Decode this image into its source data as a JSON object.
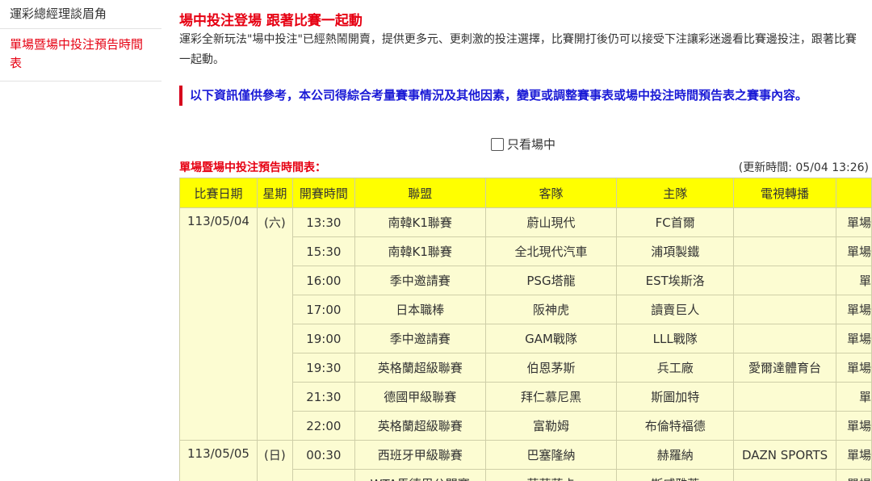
{
  "sidebar": {
    "items": [
      {
        "label": "運彩總經理談眉角",
        "active": false
      },
      {
        "label": "單場暨場中投注預告時間表",
        "active": true
      }
    ]
  },
  "main": {
    "headline": "場中投注登場 跟著比賽一起動",
    "intro": "運彩全新玩法\"場中投注\"已經熱鬧開賣，提供更多元、更刺激的投注選擇，比賽開打後仍可以接受下注讓彩迷邊看比賽邊投注，跟著比賽一起動。",
    "notice": "以下資訊僅供參考，本公司得綜合考量賽事情況及其他因素，變更或調整賽事表或場中投注時間預告表之賽事內容。",
    "filter_label": "只看場中",
    "filter_checked": false,
    "table_title": "單場暨場中投注預告時間表：",
    "update_time": "(更新時間: 05/04 13:26)"
  },
  "table": {
    "headers": [
      "比賽日期",
      "星期",
      "開賽時間",
      "聯盟",
      "客隊",
      "主隊",
      "電視轉播",
      ""
    ],
    "groups": [
      {
        "date": "113/05/04",
        "day": "(六)",
        "rows": [
          {
            "time": "13:30",
            "league": "南韓K1聯賽",
            "away": "蔚山現代",
            "home": "FC首爾",
            "tv": "",
            "type": "單場"
          },
          {
            "time": "15:30",
            "league": "南韓K1聯賽",
            "away": "全北現代汽車",
            "home": "浦項製鐵",
            "tv": "",
            "type": "單場"
          },
          {
            "time": "16:00",
            "league": "季中邀請賽",
            "away": "PSG塔龍",
            "home": "EST埃斯洛",
            "tv": "",
            "type": "單"
          },
          {
            "time": "17:00",
            "league": "日本職棒",
            "away": "阪神虎",
            "home": "讀賣巨人",
            "tv": "",
            "type": "單場"
          },
          {
            "time": "19:00",
            "league": "季中邀請賽",
            "away": "GAM戰隊",
            "home": "LLL戰隊",
            "tv": "",
            "type": "單場"
          },
          {
            "time": "19:30",
            "league": "英格蘭超級聯賽",
            "away": "伯恩茅斯",
            "home": "兵工廠",
            "tv": "愛爾達體育台",
            "type": "單場"
          },
          {
            "time": "21:30",
            "league": "德國甲級聯賽",
            "away": "拜仁慕尼黑",
            "home": "斯圖加特",
            "tv": "",
            "type": "單"
          },
          {
            "time": "22:00",
            "league": "英格蘭超級聯賽",
            "away": "富勒姆",
            "home": "布倫特福德",
            "tv": "",
            "type": "單場"
          }
        ]
      },
      {
        "date": "113/05/05",
        "day": "(日)",
        "rows": [
          {
            "time": "00:30",
            "league": "西班牙甲級聯賽",
            "away": "巴塞隆納",
            "home": "赫羅納",
            "tv": "DAZN SPORTS",
            "type": "單場"
          },
          {
            "time": "",
            "league": "WTA馬德里公開賽",
            "away": "莎莉蓮卡",
            "home": "斯威雅蒂",
            "tv": "",
            "type": "單場"
          }
        ]
      }
    ]
  },
  "colors": {
    "accent_red": "#e60012",
    "notice_blue": "#1a1ad6",
    "header_yellow": "#ffff00",
    "cell_yellow": "#fcfcd2"
  }
}
